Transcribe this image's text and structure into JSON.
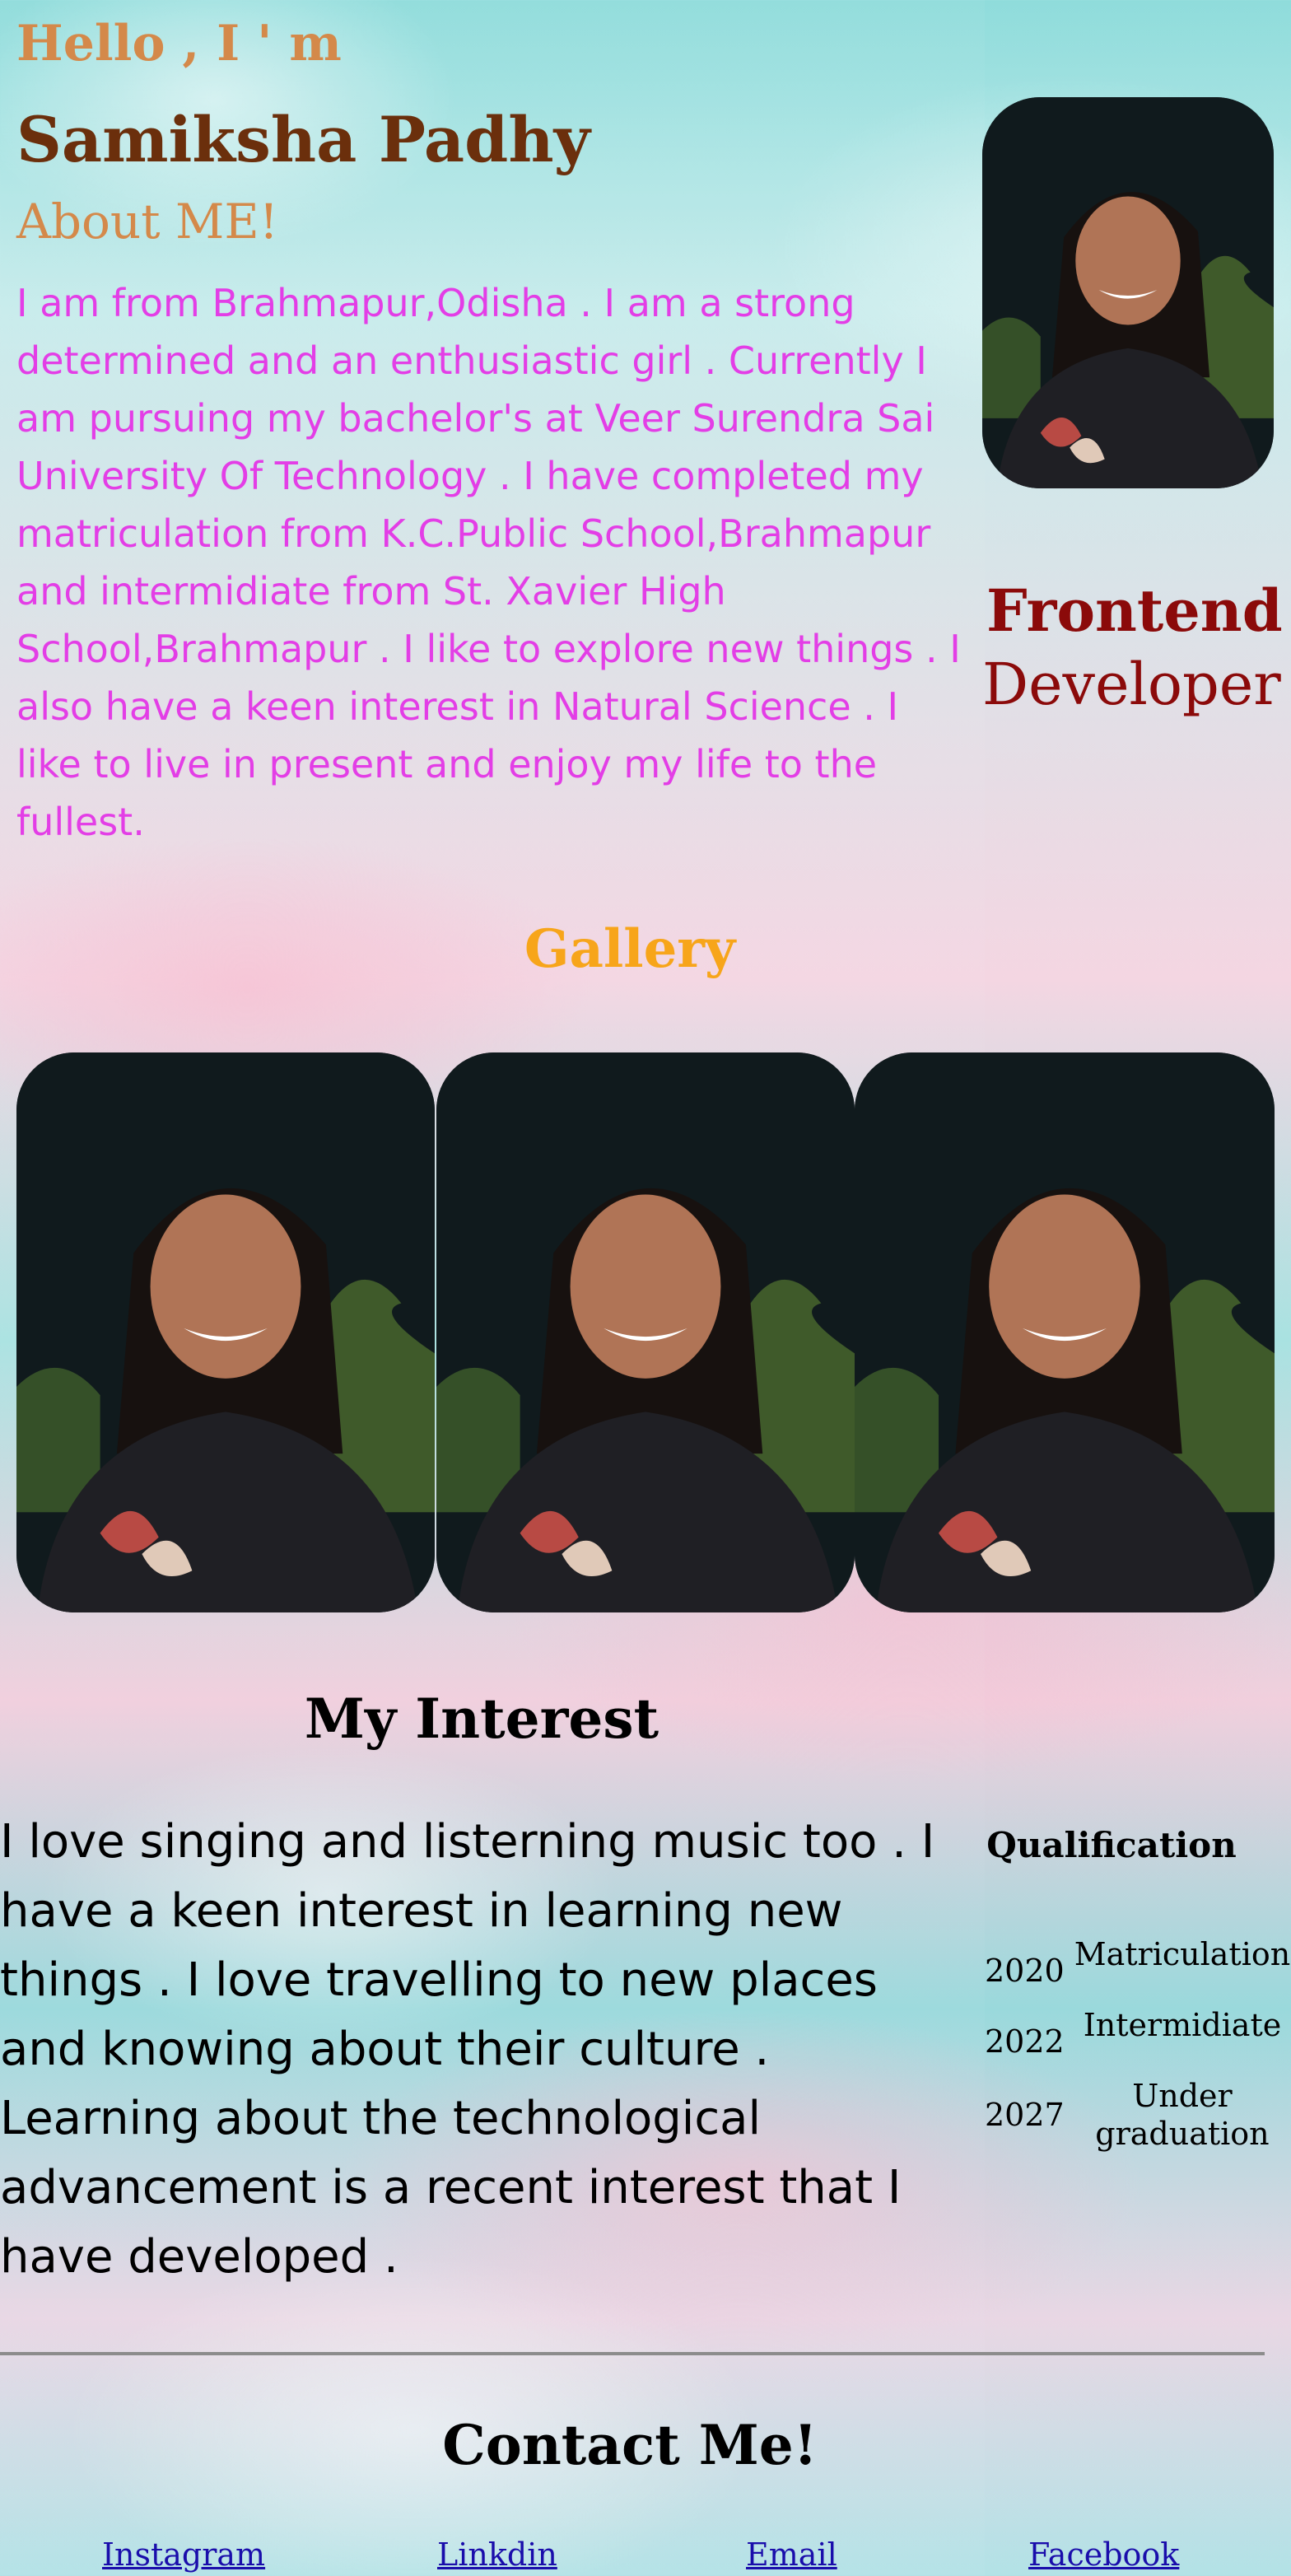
{
  "intro": {
    "greeting": "Hello , I ' m",
    "name": "Samiksha Padhy",
    "about_title": "About ME!",
    "about_text": "I am from Brahmapur,Odisha . I am a strong determined and an enthusiastic girl . Currently I am pursuing my bachelor's at Veer Surendra Sai University Of Technology . I have completed my matriculation from K.C.Public School,Brahmapur and intermidiate from St. Xavier High School,Brahmapur . I like to explore new things . I also have a keen interest in Natural Science . I like to live in present and enjoy my life to the fullest."
  },
  "role": {
    "line1": "Frontend",
    "line2": "Developer"
  },
  "gallery": {
    "title": "Gallery",
    "photo_count": 3
  },
  "interest": {
    "title": "My Interest",
    "text": "I love singing and listerning music too . I have a keen interest in learning new things . I love travelling to new places and knowing about their culture . Learning about the technological advancement is a recent interest that I have developed ."
  },
  "qualification": {
    "title": "Qualification",
    "rows": [
      {
        "year": "2020",
        "name": "Matriculation"
      },
      {
        "year": "2022",
        "name": "Intermidiate"
      },
      {
        "year": "2027",
        "name": "Under graduation"
      }
    ]
  },
  "contact": {
    "title": "Contact Me!",
    "links": [
      "Instagram",
      "Linkdin",
      "Email",
      "Facebook"
    ]
  },
  "colors": {
    "greeting": "#d4894a",
    "name": "#6b2f0c",
    "about_text": "#e33ee6",
    "role": "#8b0a0a",
    "gallery_title": "#f7a51a",
    "link": "#1a0dab"
  }
}
